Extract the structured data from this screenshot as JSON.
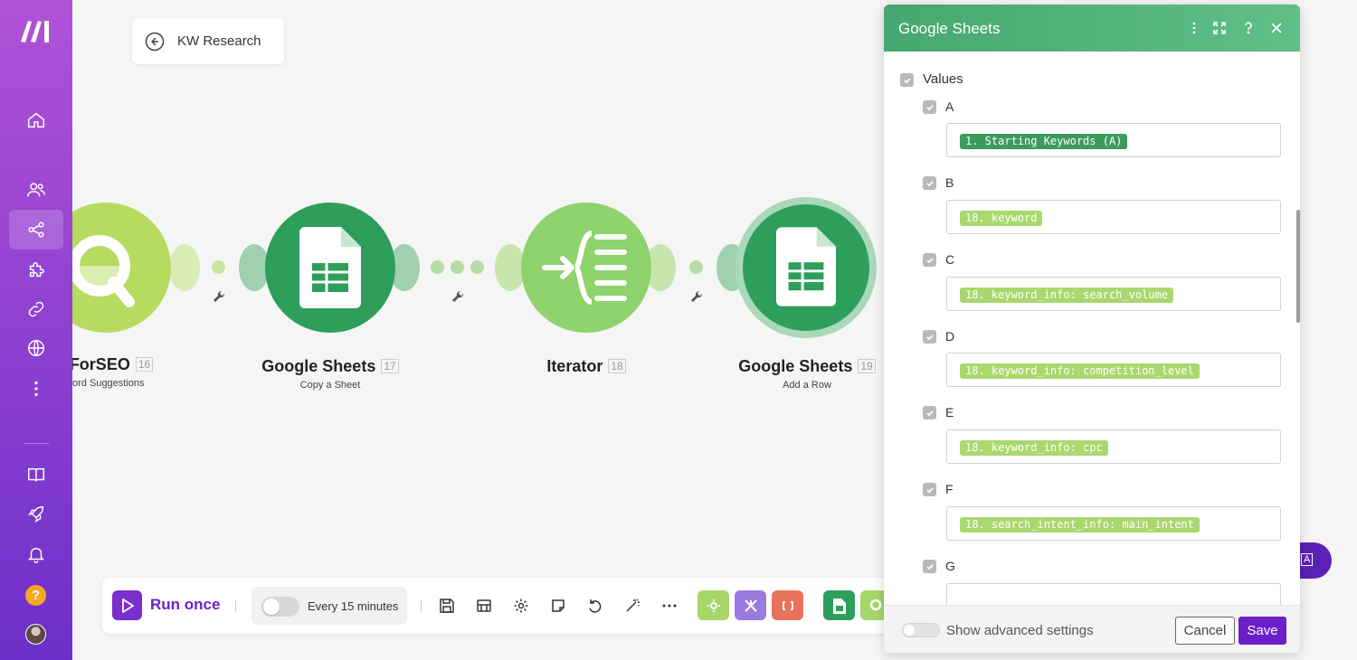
{
  "scenario": {
    "name": "KW Research"
  },
  "nodes": [
    {
      "title": "ataForSEO",
      "number": "16",
      "subtitle": "eyword Suggestions"
    },
    {
      "title": "Google Sheets",
      "number": "17",
      "subtitle": "Copy a Sheet"
    },
    {
      "title": "Iterator",
      "number": "18",
      "subtitle": ""
    },
    {
      "title": "Google Sheets",
      "number": "19",
      "subtitle": "Add a Row"
    }
  ],
  "toolbar": {
    "run_label": "Run once",
    "schedule_label": "Every 15 minutes"
  },
  "pill_text": "A",
  "panel": {
    "title": "Google Sheets",
    "root_label": "Values",
    "fields": [
      {
        "label": "A",
        "token": "1. Starting Keywords (A)",
        "style": "dark"
      },
      {
        "label": "B",
        "token": "18. keyword",
        "style": "light"
      },
      {
        "label": "C",
        "token": "18. keyword_info: search_volume",
        "style": "light"
      },
      {
        "label": "D",
        "token": "18. keyword_info: competition_level",
        "style": "light"
      },
      {
        "label": "E",
        "token": "18. keyword_info: cpc",
        "style": "light"
      },
      {
        "label": "F",
        "token": "18. search_intent_info: main_intent",
        "style": "light"
      },
      {
        "label": "G",
        "token": "",
        "style": "none"
      }
    ],
    "footer": {
      "advanced_label": "Show advanced settings",
      "cancel_label": "Cancel",
      "save_label": "Save"
    }
  },
  "colors": {
    "sheets_green": "#2e9e5b",
    "dataforseo_lime": "#a9d86e",
    "iterator_green": "#8ed36b",
    "brand_purple": "#6b1fc8"
  }
}
